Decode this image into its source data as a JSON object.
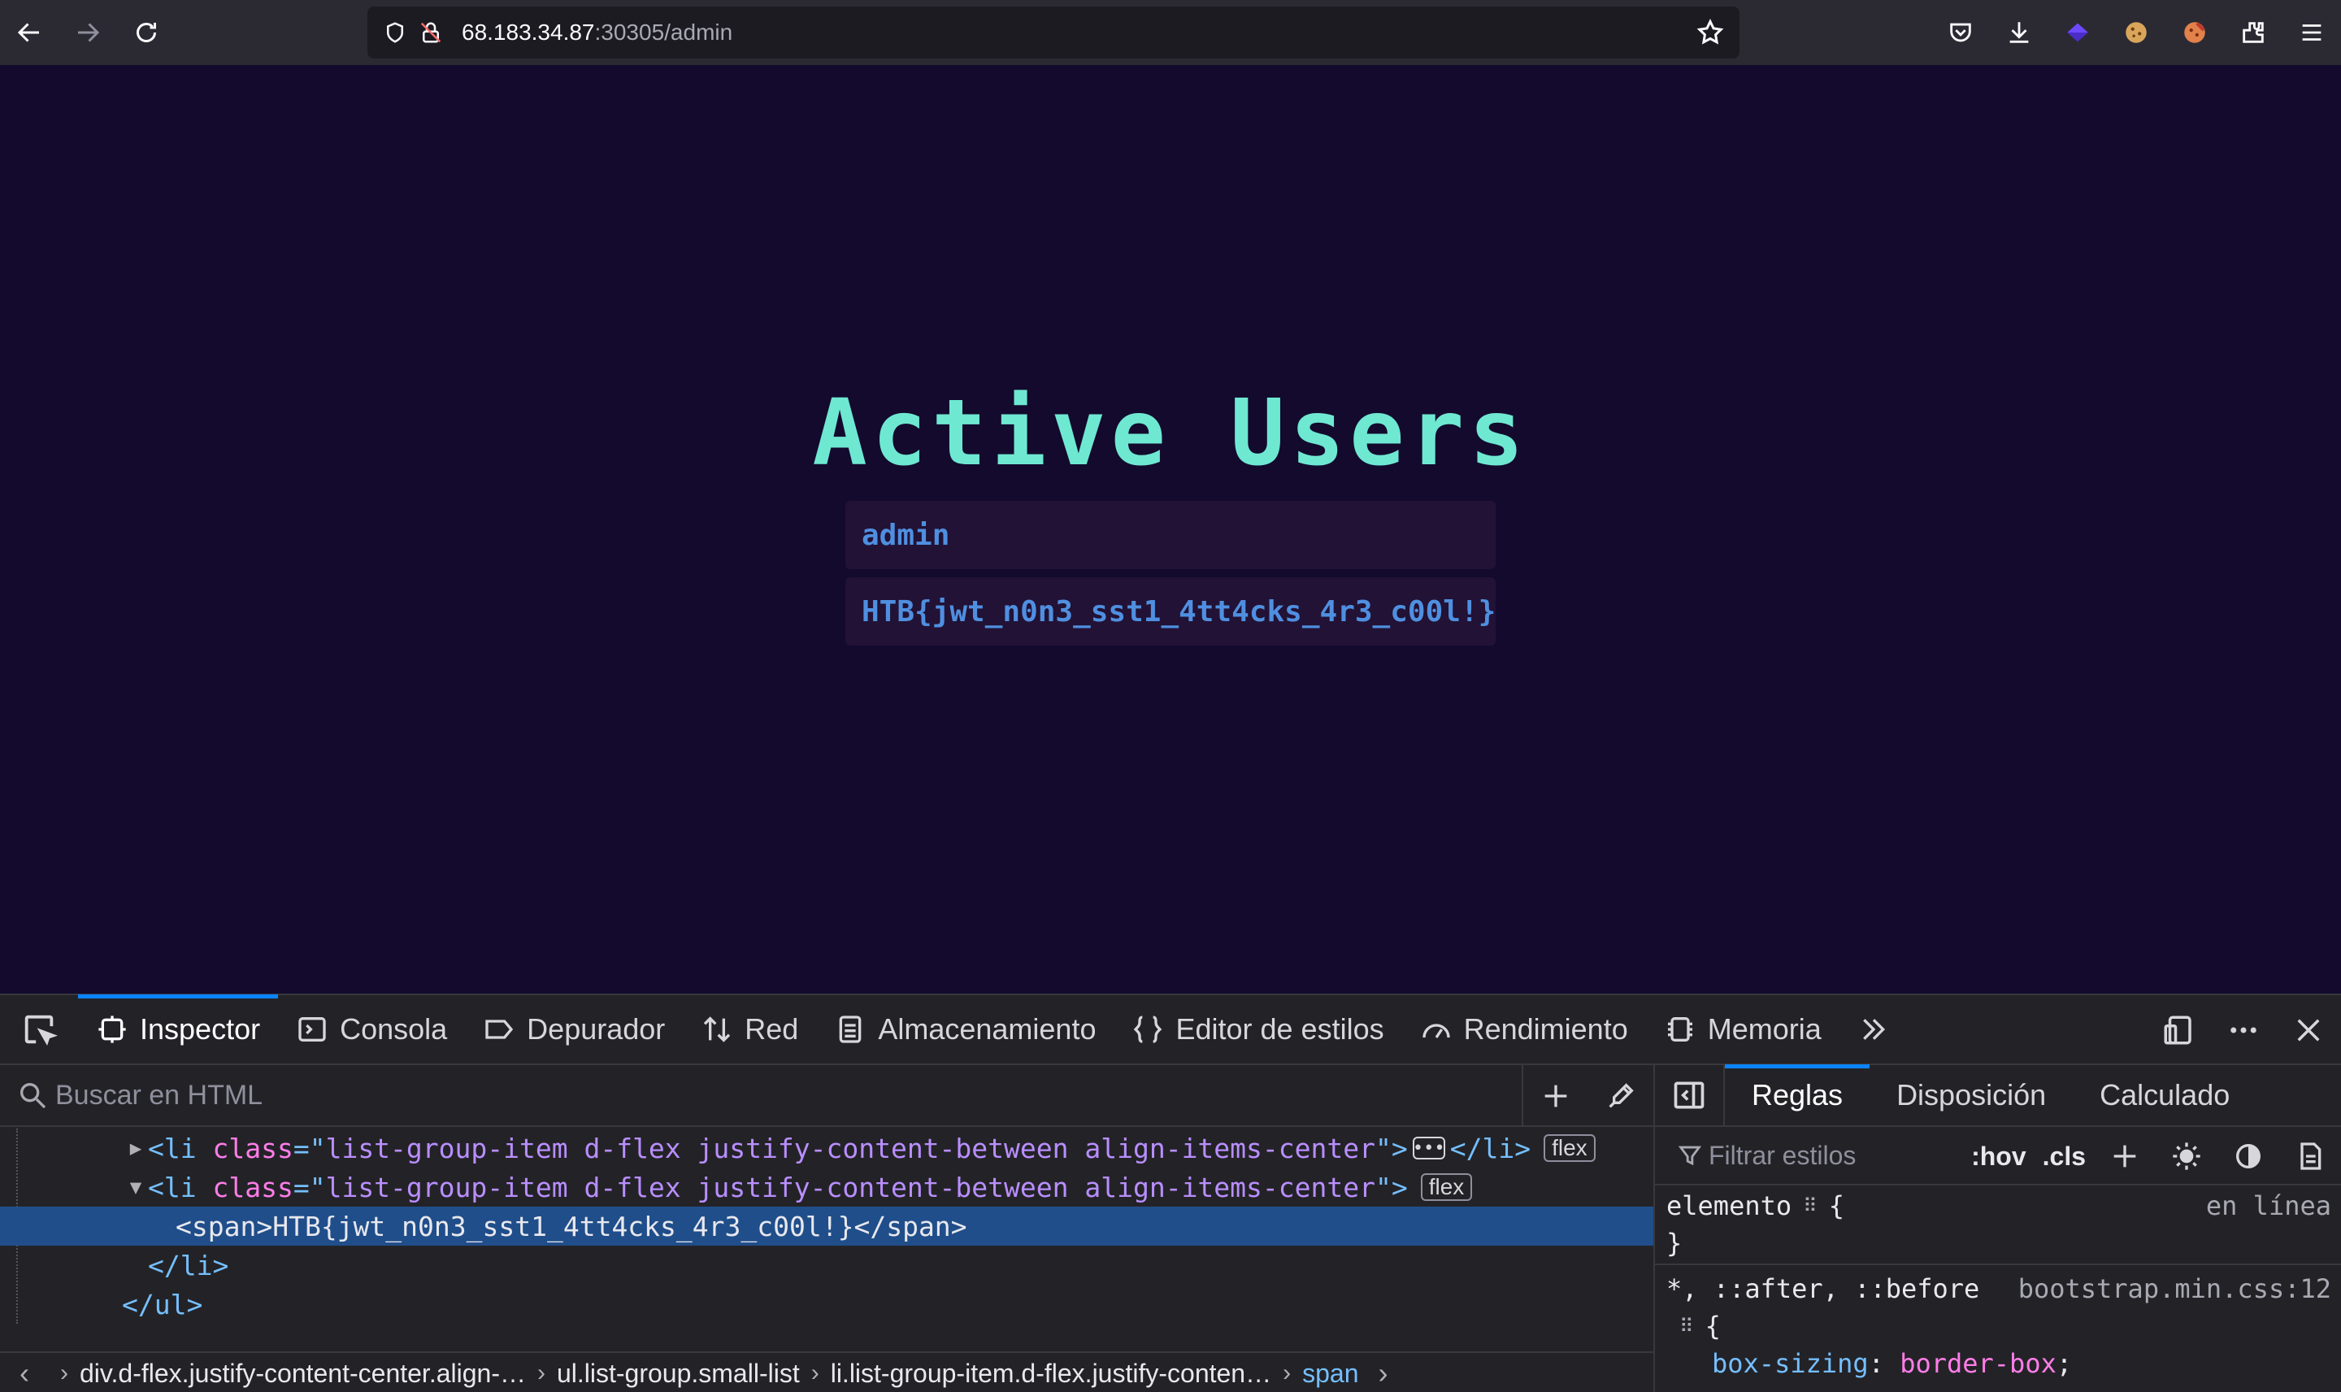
{
  "browser": {
    "url_host": "68.183.34.87",
    "url_path": ":30305/admin"
  },
  "page": {
    "title": "Active Users",
    "users": [
      "admin",
      "HTB{jwt_n0n3_sst1_4tt4cks_4r3_c00l!}"
    ]
  },
  "devtools": {
    "tabs": [
      "Inspector",
      "Consola",
      "Depurador",
      "Red",
      "Almacenamiento",
      "Editor de estilos",
      "Rendimiento",
      "Memoria"
    ],
    "search_placeholder": "Buscar en HTML",
    "markup": {
      "li_tag_open": "<li",
      "attr_name": "class",
      "eq": "=\"",
      "class_value": "list-group-item d-flex justify-content-between align-items-center ",
      "close_quote": "\">",
      "li_close": "</li>",
      "flex_badge": "flex",
      "span_open": "<span>",
      "span_text": "HTB{jwt_n0n3_sst1_4tt4cks_4r3_c00l!}",
      "span_close": "</span>",
      "ul_close": "</ul>"
    },
    "breadcrumbs": [
      "div.d-flex.justify-content-center.align-…",
      "ul.list-group.small-list",
      "li.list-group-item.d-flex.justify-conten…",
      "span"
    ],
    "rules_tabs": [
      "Reglas",
      "Disposición",
      "Calculado"
    ],
    "filter_placeholder": "Filtrar estilos",
    "hov": ":hov",
    "cls": ".cls",
    "rules": {
      "element_selector": "elemento",
      "element_source": "en línea",
      "open_brace": "{",
      "close_brace": "}",
      "rule2_selector": "*, ::after, ::before",
      "rule2_source": "bootstrap.min.css:12",
      "prop_name": "box-sizing",
      "prop_value": "border-box"
    }
  },
  "colors": {
    "page_bg": "#130a2e",
    "title": "#6fe8d2",
    "user_text": "#4f8fe0",
    "selection": "#204e8a",
    "accent": "#0a84ff"
  }
}
